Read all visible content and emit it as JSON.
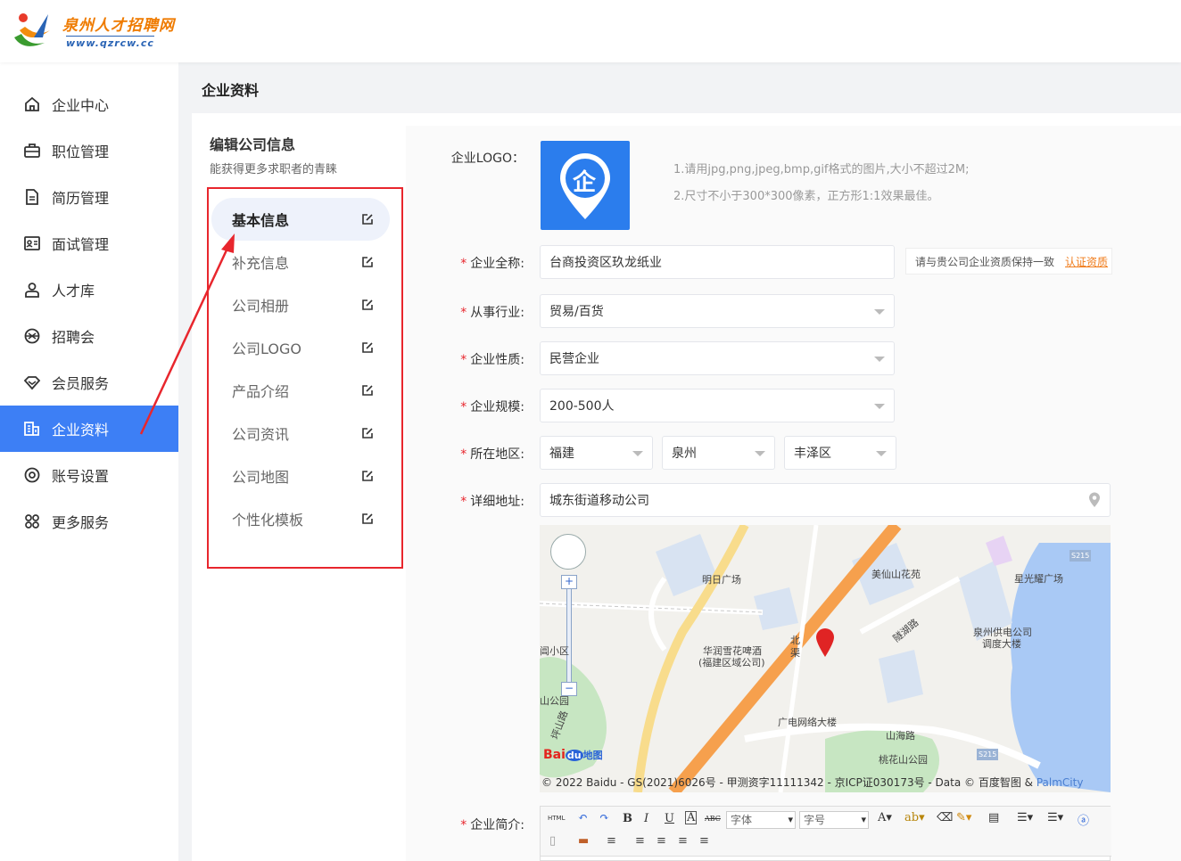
{
  "header": {
    "logo_cn": "泉州人才招聘网",
    "logo_url": "www.qzrcw.cc"
  },
  "sidebar": {
    "items": [
      {
        "label": "企业中心",
        "icon": "home-icon"
      },
      {
        "label": "职位管理",
        "icon": "briefcase-icon"
      },
      {
        "label": "简历管理",
        "icon": "document-icon"
      },
      {
        "label": "面试管理",
        "icon": "id-card-icon"
      },
      {
        "label": "人才库",
        "icon": "person-icon"
      },
      {
        "label": "招聘会",
        "icon": "venue-icon"
      },
      {
        "label": "会员服务",
        "icon": "diamond-icon"
      },
      {
        "label": "企业资料",
        "icon": "building-icon",
        "active": true
      },
      {
        "label": "账号设置",
        "icon": "settings-icon"
      },
      {
        "label": "更多服务",
        "icon": "apps-icon"
      }
    ]
  },
  "page": {
    "title": "企业资料",
    "edit_title": "编辑公司信息",
    "edit_sub": "能获得更多求职者的青睐"
  },
  "submenu": [
    {
      "label": "基本信息",
      "active": true
    },
    {
      "label": "补充信息"
    },
    {
      "label": "公司相册"
    },
    {
      "label": "公司LOGO"
    },
    {
      "label": "产品介绍"
    },
    {
      "label": "公司资讯"
    },
    {
      "label": "公司地图"
    },
    {
      "label": "个性化模板"
    }
  ],
  "form": {
    "logo_label": "企业LOGO：",
    "logo_char": "企",
    "logo_tip1": "1.请用jpg,png,jpeg,bmp,gif格式的图片,大小不超过2M;",
    "logo_tip2": "2.尺寸不小于300*300像素，正方形1:1效果最佳。",
    "name_label": "企业全称:",
    "name_value": "台商投资区玖龙纸业",
    "name_hint": "请与贵公司企业资质保持一致",
    "name_verify": "认证资质",
    "industry_label": "从事行业:",
    "industry_value": "贸易/百货",
    "nature_label": "企业性质:",
    "nature_value": "民营企业",
    "scale_label": "企业规模:",
    "scale_value": "200-500人",
    "region_label": "所在地区:",
    "region_province": "福建",
    "region_city": "泉州",
    "region_district": "丰泽区",
    "address_label": "详细地址:",
    "address_value": "城东街道移动公司",
    "intro_label": "企业简介:",
    "required_mark": "*"
  },
  "map": {
    "labels": {
      "mingri": "明日广场",
      "meixian": "美仙山花苑",
      "xingguang": "星光耀广场",
      "gongdian1": "泉州供电公司",
      "gongdian2": "调度大楼",
      "huarun1": "华润雪花啤酒",
      "huarun2": "(福建区域公司)",
      "guangdian": "广电网络大楼",
      "shanhai": "山海路",
      "taohua": "桃花山公园",
      "xiaoqu": "阊小区",
      "shangongyuan": "山公园",
      "bei": "北",
      "qu": "渠",
      "quanxiu": "隧湖路",
      "s215a": "S215",
      "s215b": "S215",
      "pingshan": "坪山路"
    },
    "baidu": "Bai",
    "baidu_du": "du",
    "baidu_tail": "地图",
    "copyright": "© 2022 Baidu - GS(2021)6026号 - 甲测资字11111342 - 京ICP证030173号 - Data © 百度智图 & ",
    "palmcity": "PalmCity"
  },
  "editor": {
    "html": "HTML",
    "bold": "B",
    "italic": "I",
    "underline": "U",
    "font_a": "A",
    "strike": "ABC",
    "font_family": "字体",
    "font_size": "字号"
  }
}
